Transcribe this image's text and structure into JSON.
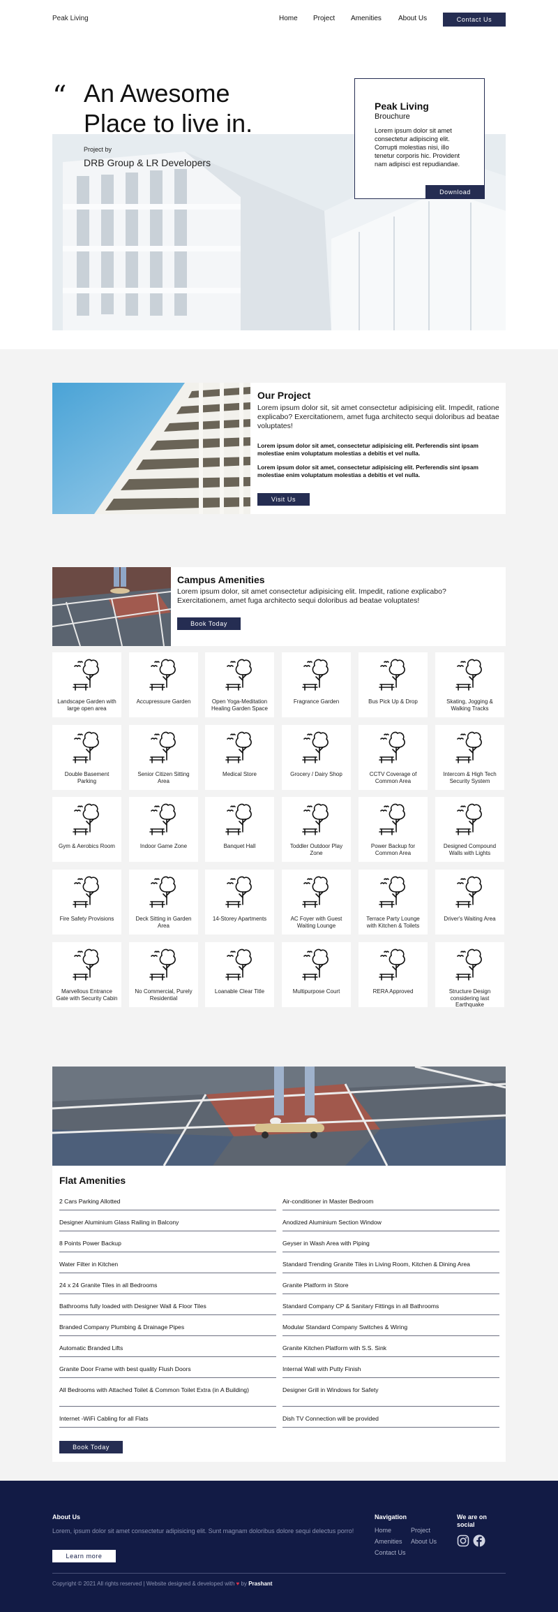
{
  "header": {
    "logo": "Peak Living",
    "nav": [
      "Home",
      "Project",
      "Amenities",
      "About Us"
    ],
    "cta": "Contact Us"
  },
  "hero": {
    "quote_mark": "“",
    "title": "An Awesome Place to live in.",
    "project_by_label": "Project by",
    "project_by": "DRB Group & LR Developers",
    "brochure": {
      "title": "Peak Living",
      "subtitle": "Brouchure",
      "text": "Lorem ipsum dolor sit amet consectetur adipiscing elit. Corrupti molestias nisi, illo tenetur corporis hic. Provident nam adipisci est repudiandae.",
      "button": "Download"
    }
  },
  "project": {
    "title": "Our Project",
    "lead": "Lorem ipsum dolor sit, sit amet consectetur adipisicing elit. Impedit, ratione explicabo? Exercitationem, amet fuga architecto sequi doloribus ad beatae voluptates!",
    "bold1": "Lorem ipsum dolor sit amet, consectetur adipisicing elit. Perferendis sint ipsam molestiae enim voluptatum molestias a debitis et vel nulla.",
    "bold2": "Lorem ipsum dolor sit amet, consectetur adipisicing elit. Perferendis sint ipsam molestiae enim voluptatum molestias a debitis et vel nulla.",
    "button": "Visit Us"
  },
  "campus": {
    "title": "Campus Amenities",
    "lead": "Lorem ipsum dolor, sit amet consectetur adipisicing elit. Impedit, ratione explicabo? Exercitationem, amet fuga architecto sequi doloribus ad beatae voluptates!",
    "button": "Book Today",
    "items": [
      "Landscape Garden with large open area",
      "Accupressure Garden",
      "Open Yoga-Meditation Healing Garden Space",
      "Fragrance Garden",
      "Bus Pick Up & Drop",
      "Skating, Jogging & Walking Tracks",
      "Double Basement Parking",
      "Senior Citizen Sitting Area",
      "Medical Store",
      "Grocery / Dairy Shop",
      "CCTV Coverage of Common Area",
      "Intercom & High Tech Security System",
      "Gym & Aerobics Room",
      "Indoor Game Zone",
      "Banquet Hall",
      "Toddler Outdoor Play Zone",
      "Power Backup for Common Area",
      "Designed Compound Walls with Lights",
      "Fire Safety Provisions",
      "Deck Sitting in Garden Area",
      "14-Storey Apartments",
      "AC Foyer with Guest Waiting Lounge",
      "Terrace Party Lounge with Kitchen & Toilets",
      "Driver's Waiting Area",
      "Marvellous Entrance Gate with Security Cabin",
      "No Commercial, Purely Residential",
      "Loanable Clear Title",
      "Multipurpose Court",
      "RERA Approved",
      "Structure Design considering last Earthquake"
    ]
  },
  "flat": {
    "title": "Flat Amenities",
    "left": [
      "2 Cars Parking Allotted",
      "Designer Aluminium Glass Railing in Balcony",
      "8 Points Power Backup",
      "Water Filter in Kitchen",
      "24 x 24 Granite Tiles in all Bedrooms",
      "Bathrooms fully loaded with Designer Wall & Floor Tiles",
      "Branded Company Plumbing & Drainage Pipes",
      "Automatic Branded Lifts",
      "Granite Door Frame with best quality Flush Doors",
      "All Bedrooms with Attached Toilet & Common Toilet Extra (in A Building)",
      "Internet -WiFi Cabling for all Flats"
    ],
    "right": [
      "Air-conditioner in Master Bedroom",
      "Anodized Aluminium Section Window",
      "Geyser in Wash Area with Piping",
      "Standard Trending Granite Tiles in Living Room, Kitchen & Dining Area",
      "Granite Platform in Store",
      "Standard Company CP & Sanitary Fittings in all Bathrooms",
      "Modular Standard Company Switches & Wiring",
      "Granite Kitchen Platform with S.S. Sink",
      "Internal Wall with Putty Finish",
      "Designer Grill in Windows for Safety",
      "Dish TV Connection will be provided"
    ],
    "button": "Book Today"
  },
  "footer": {
    "about_title": "About Us",
    "about_text": "Lorem, ipsum dolor sit amet consectetur adipisicing elit. Sunt magnam doloribus dolore sequi delectus porro!",
    "learn_button": "Learn more",
    "nav_title": "Navigation",
    "nav": [
      "Home",
      "Project",
      "Amenities",
      "About Us",
      "Contact Us"
    ],
    "social_title": "We are on social",
    "copyright": "Copyright © 2021 All rights reserved | Website designed & developed with",
    "heart": "♥",
    "by": "by",
    "author": "Prashant",
    "colors": {
      "navy": "#252d52",
      "footer_bg": "#121b45",
      "heart": "#e0324b"
    }
  }
}
